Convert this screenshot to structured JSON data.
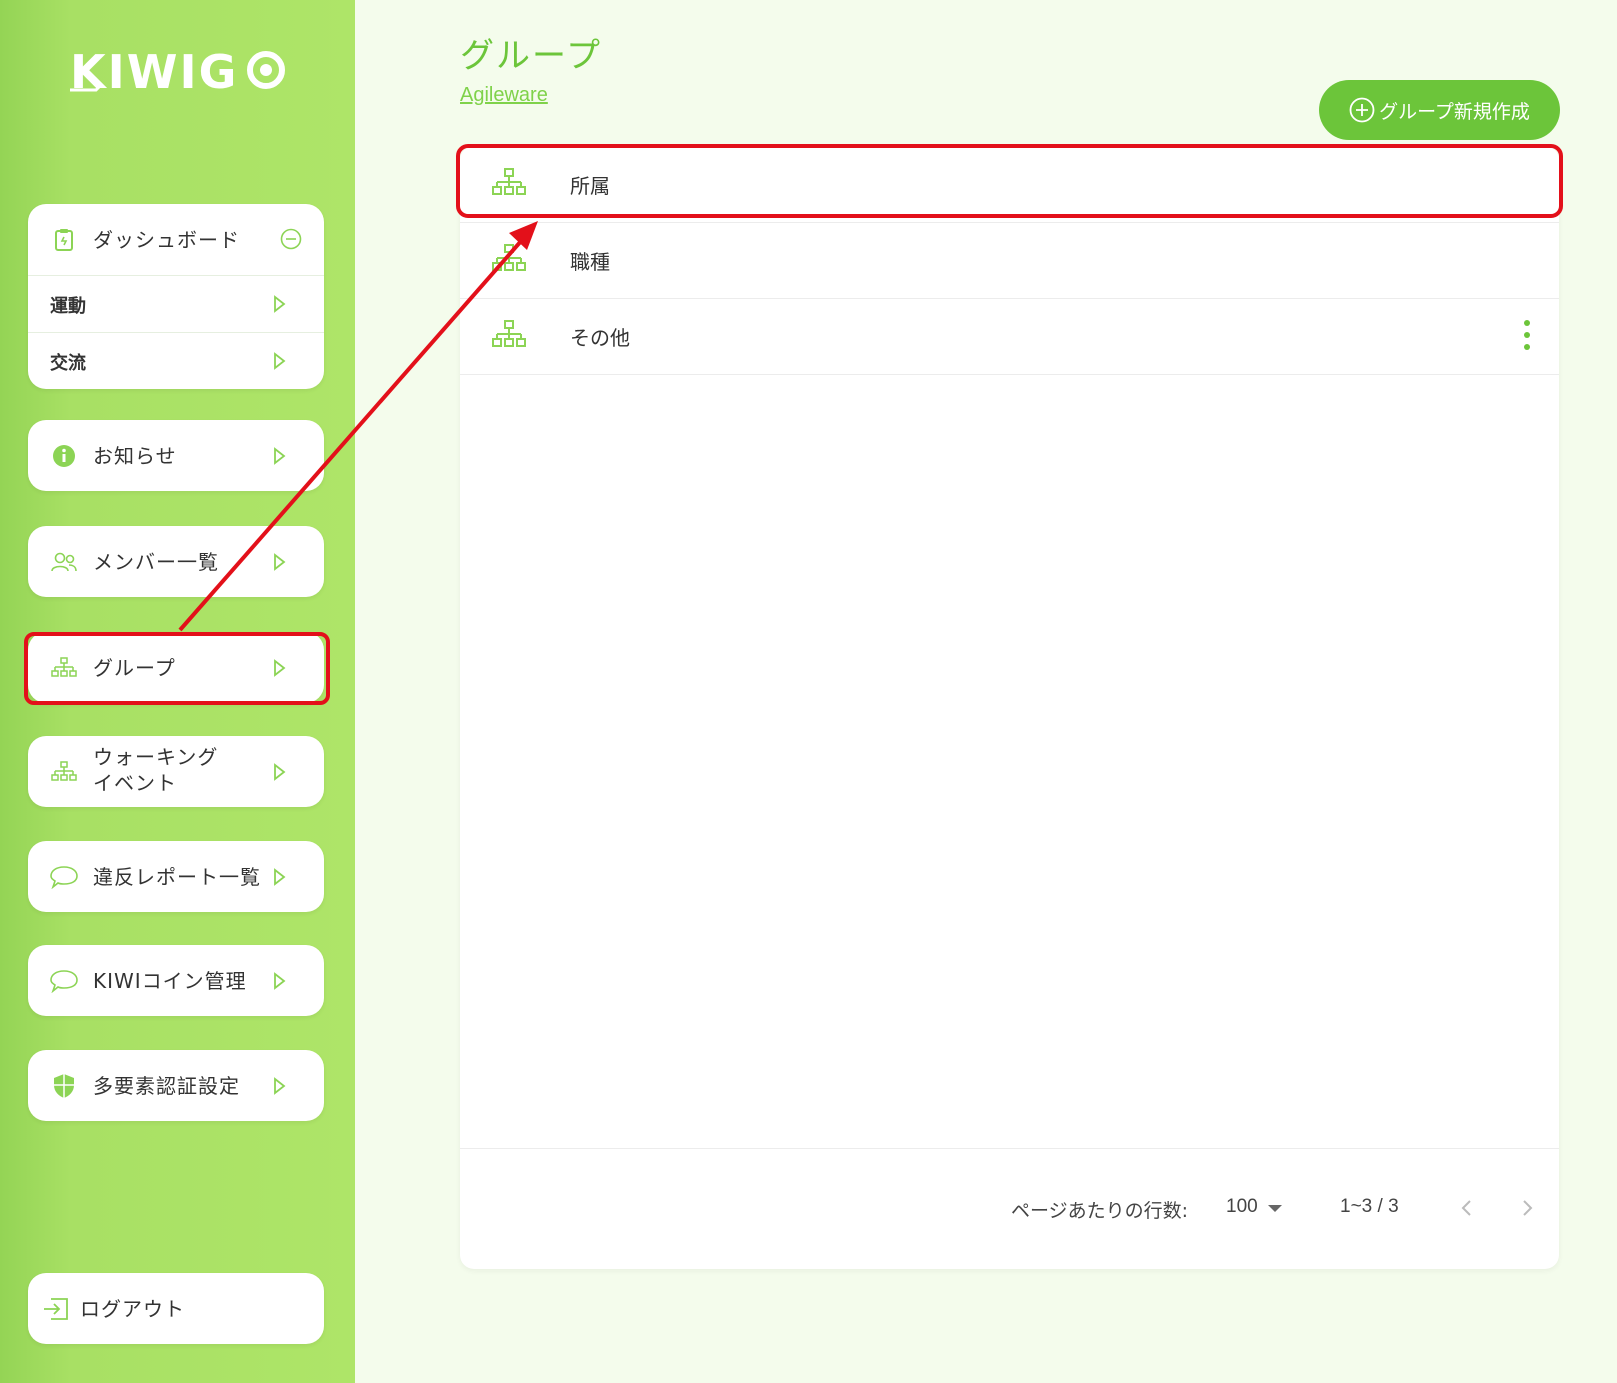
{
  "brand": {
    "logo_text": "KIWIGO",
    "accent": "#6cc53a",
    "sidebar_bg": "#aee568",
    "highlight": "#e3101a"
  },
  "sidebar": {
    "dashboard": {
      "label": "ダッシュボード",
      "icon": "clipboard-icon",
      "children": [
        "運動",
        "交流"
      ]
    },
    "items": [
      {
        "label": "お知らせ",
        "icon": "info-icon"
      },
      {
        "label": "メンバー一覧",
        "icon": "users-icon"
      },
      {
        "label": "グループ",
        "icon": "org-chart-icon"
      },
      {
        "label": "ウォーキング\nイベント",
        "icon": "org-chart-icon"
      },
      {
        "label": "違反レポート一覧",
        "icon": "chat-bubble-icon"
      },
      {
        "label": "KIWIコイン管理",
        "icon": "chat-bubble-icon"
      },
      {
        "label": "多要素認証設定",
        "icon": "shield-icon"
      }
    ],
    "logout": "ログアウト"
  },
  "main": {
    "title": "グループ",
    "breadcrumb": "Agileware",
    "new_button": "グループ新規作成",
    "groups": [
      "所属",
      "職種",
      "その他"
    ],
    "pagination": {
      "rows_per_page_label": "ページあたりの行数:",
      "rows_per_page": "100",
      "range": "1~3 / 3"
    }
  }
}
